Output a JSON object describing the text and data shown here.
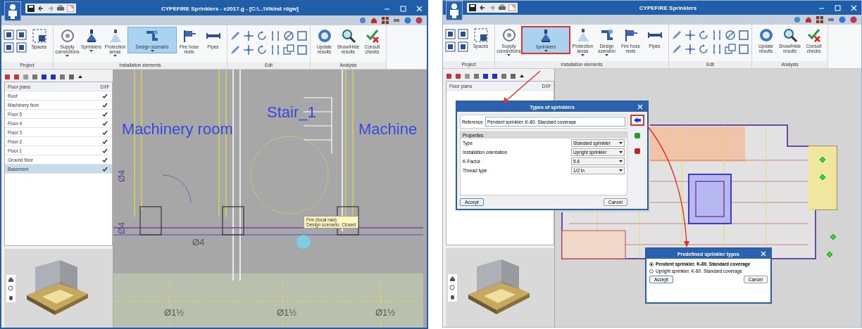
{
  "windows": [
    {
      "title": "CYPEFIRE Sprinklers - e2017.g - [C:\\...\\Vikind rdgw]",
      "ribbon": [
        {
          "kind": "project",
          "label": "Project",
          "buttons": [
            {
              "label": "Spaces",
              "selected": false,
              "highlighted": false
            }
          ]
        },
        {
          "kind": "tools",
          "label": "Installation elements",
          "buttons": [
            {
              "label": "Supply connections",
              "selected": false,
              "highlighted": false
            },
            {
              "label": "Sprinklers",
              "selected": false,
              "highlighted": false
            },
            {
              "label": "Protection areas",
              "selected": false,
              "highlighted": false
            },
            {
              "label": "Design scenario",
              "selected": true,
              "highlighted": false
            },
            {
              "label": "Fire hose reels",
              "selected": false,
              "highlighted": false
            },
            {
              "label": "Pipes",
              "selected": false,
              "highlighted": false
            }
          ]
        },
        {
          "kind": "edit",
          "label": "Edit"
        },
        {
          "kind": "tools",
          "label": "Analysis",
          "buttons": [
            {
              "label": "Update results",
              "selected": false,
              "highlighted": false
            },
            {
              "label": "Show/Hide results",
              "selected": false,
              "highlighted": false
            },
            {
              "label": "Consult checks",
              "selected": false,
              "highlighted": false
            }
          ]
        }
      ],
      "floor_panel": {
        "columns": [
          "Floor plans",
          "DXF"
        ],
        "rows": [
          {
            "name": "Roof",
            "checked": true,
            "selected": false
          },
          {
            "name": "Machinery floor",
            "checked": true,
            "selected": false
          },
          {
            "name": "Floor 5",
            "checked": true,
            "selected": false
          },
          {
            "name": "Floor 4",
            "checked": true,
            "selected": false
          },
          {
            "name": "Floor 3",
            "checked": true,
            "selected": false
          },
          {
            "name": "Floor 2",
            "checked": true,
            "selected": false
          },
          {
            "name": "Floor 1",
            "checked": true,
            "selected": false
          },
          {
            "name": "Ground floor",
            "checked": true,
            "selected": false
          },
          {
            "name": "Basement",
            "checked": true,
            "selected": true
          }
        ]
      },
      "canvas": {
        "kind": "section",
        "labels": [
          {
            "text": "Machinery room",
            "kind": "room"
          },
          {
            "text": "Stair_1",
            "kind": "room"
          },
          {
            "text": "Machine",
            "kind": "room"
          },
          {
            "text": "Ø4",
            "kind": "dim-v"
          },
          {
            "text": "Ø4",
            "kind": "dim-v"
          },
          {
            "text": "Ø4",
            "kind": "dim-h"
          },
          {
            "text": "Ø1½",
            "kind": "dim-h"
          },
          {
            "text": "Ø1½",
            "kind": "dim-h"
          },
          {
            "text": "Ø1½",
            "kind": "dim-h"
          }
        ],
        "tooltip": [
          "Fire (local raw)",
          "Design scenario: Closed"
        ]
      }
    },
    {
      "title": "CYPEFIRE Sprinklers",
      "ribbon": [
        {
          "kind": "project",
          "label": "Project",
          "buttons": [
            {
              "label": "Spaces",
              "selected": false,
              "highlighted": false
            }
          ]
        },
        {
          "kind": "tools",
          "label": "Installation elements",
          "buttons": [
            {
              "label": "Supply connections",
              "selected": false,
              "highlighted": false
            },
            {
              "label": "Sprinklers",
              "selected": true,
              "highlighted": true
            },
            {
              "label": "Protection areas",
              "selected": false,
              "highlighted": false
            },
            {
              "label": "Design scenario",
              "selected": false,
              "highlighted": false
            },
            {
              "label": "Fire hose reels",
              "selected": false,
              "highlighted": false
            },
            {
              "label": "Pipes",
              "selected": false,
              "highlighted": false
            }
          ]
        },
        {
          "kind": "edit",
          "label": "Edit"
        },
        {
          "kind": "tools",
          "label": "Analysis",
          "buttons": [
            {
              "label": "Update results",
              "selected": false,
              "highlighted": false
            },
            {
              "label": "Show/Hide results",
              "selected": false,
              "highlighted": false
            },
            {
              "label": "Consult checks",
              "selected": false,
              "highlighted": false
            }
          ]
        }
      ],
      "floor_panel": {
        "columns": [
          "Floor plans",
          "DXF"
        ]
      },
      "canvas": {
        "kind": "plan"
      },
      "dialogs": [
        {
          "kind": "properties",
          "title": "Types of sprinklers",
          "reference_label": "Reference",
          "reference_value": "Pendent sprinkler. K-80. Standard coverage",
          "section": "Properties",
          "fields": [
            {
              "label": "Type",
              "value": "Standard sprinkler"
            },
            {
              "label": "Installation orientation",
              "value": "Upright sprinkler"
            },
            {
              "label": "K-Factor",
              "value": "5.6"
            },
            {
              "label": "Thread type",
              "value": "1/2 in"
            }
          ],
          "side_buttons": [
            {
              "highlighted": true
            },
            {
              "highlighted": false
            },
            {
              "highlighted": false
            }
          ],
          "buttons": [
            "Accept",
            "Cancel"
          ]
        },
        {
          "kind": "choice",
          "title": "Predefined sprinkler types",
          "options": [
            {
              "label": "Pendent sprinkler. K-80. Standard coverage",
              "selected": true
            },
            {
              "label": "Upright sprinkler. K-80. Standard coverage",
              "selected": false
            }
          ],
          "buttons": [
            "Accept",
            "Cancel"
          ]
        }
      ]
    }
  ]
}
